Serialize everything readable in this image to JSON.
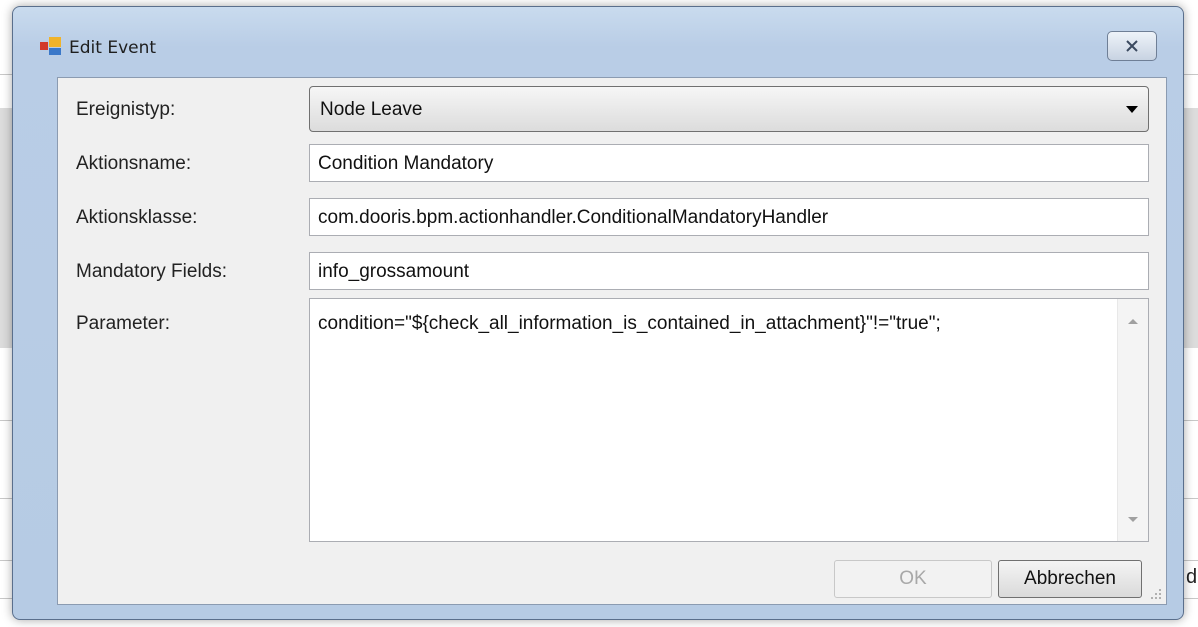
{
  "window": {
    "title": "Edit Event",
    "icon": "app-window-icon",
    "close_icon": "close-x-icon"
  },
  "form": {
    "event_type": {
      "label": "Ereignistyp:",
      "value": "Node Leave"
    },
    "action_name": {
      "label": "Aktionsname:",
      "value": "Condition Mandatory"
    },
    "action_class": {
      "label": "Aktionsklasse:",
      "value": "com.dooris.bpm.actionhandler.ConditionalMandatoryHandler"
    },
    "mandatory_fields": {
      "label": "Mandatory Fields:",
      "value": "info_grossamount"
    },
    "parameter": {
      "label": "Parameter:",
      "value": "condition=\"${check_all_information_is_contained_in_attachment}\"!=\"true\";"
    }
  },
  "buttons": {
    "ok_label": "OK",
    "ok_enabled": false,
    "cancel_label": "Abbrechen"
  },
  "background": {
    "fragment_text": "d"
  },
  "colors": {
    "title_bar": "#b9cde6",
    "client_bg": "#f0f0f0",
    "disabled_text": "#a8a8a8"
  }
}
